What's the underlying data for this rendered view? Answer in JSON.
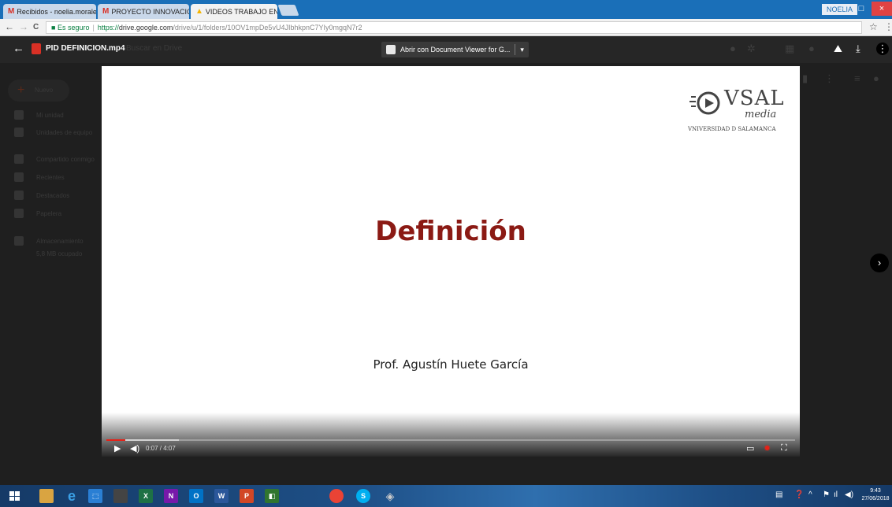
{
  "browser": {
    "tabs": [
      {
        "favicon": "M",
        "title": "Recibidos - noelia.morale",
        "close": "×"
      },
      {
        "favicon": "M",
        "title": "PROYECTO INNOVACIÓN",
        "close": "×"
      },
      {
        "favicon": "▲",
        "title": "VIDEOS TRABAJO EN EQ",
        "close": "×"
      }
    ],
    "user_badge": "NOELIA",
    "window_buttons": {
      "minimize": "–",
      "maximize": "□",
      "close": "×"
    },
    "nav": {
      "back": "←",
      "forward": "→",
      "reload": "C"
    },
    "address": {
      "secure_label": "Es seguro",
      "separator": "|",
      "url_scheme": "https://",
      "url_host": "drive.google.com",
      "url_path": "/drive/u/1/folders/10OV1mpDe5vU4JIbhkpnC7YIy0mgqN7r2"
    },
    "bookmark_star": "☆",
    "menu": "⋮"
  },
  "drive": {
    "back": "←",
    "file_title": "PID DEFINICION.mp4",
    "search_placeholder": "Buscar en Drive",
    "open_with": "Abrir con Document Viewer for G...",
    "open_with_caret": "▾",
    "top_icons": {
      "add_to_drive": "⛰",
      "download": "⤓",
      "more": "⋮"
    },
    "new_button": "Nuevo",
    "new_plus": "+",
    "sidebar": [
      {
        "label": "Mi unidad"
      },
      {
        "label": "Unidades de equipo"
      },
      {
        "label": "Compartido conmigo"
      },
      {
        "label": "Recientes"
      },
      {
        "label": "Destacados"
      },
      {
        "label": "Papelera"
      },
      {
        "label": "Almacenamiento"
      },
      {
        "label": "5,8 MB ocupado"
      }
    ],
    "next": "›"
  },
  "video": {
    "logo": {
      "brand": "VSAL",
      "sub": "media",
      "university": "VNIVERSIDAD D SALAMANCA"
    },
    "slide_title": "Definición",
    "slide_author": "Prof. Agustín Huete García",
    "time_display": "0:07 / 4:07",
    "progress_fraction": 0.028,
    "buffered_fraction": 0.105,
    "play_icon": "▶",
    "volume_icon": "◀)",
    "colors": {
      "title": "#8b1a14",
      "progress": "#e62117"
    }
  },
  "taskbar": {
    "clock_time": "9:43",
    "clock_date": "27/06/2018",
    "apps": [
      "file-explorer",
      "edge",
      "store",
      "paint",
      "excel",
      "onenote",
      "outlook",
      "word",
      "powerpoint",
      "project",
      "chrome",
      "skype",
      "paint3d"
    ]
  }
}
